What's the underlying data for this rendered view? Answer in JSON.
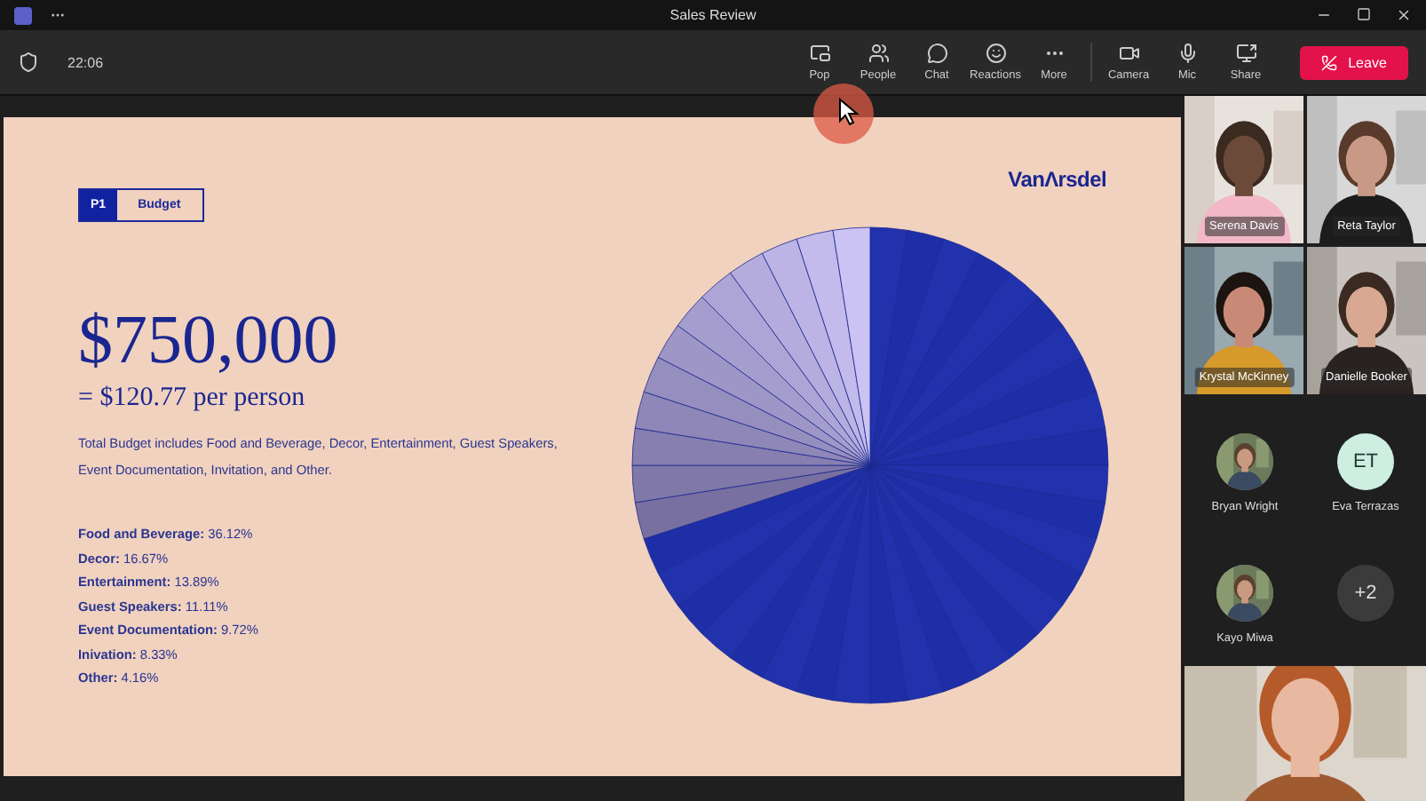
{
  "window": {
    "title": "Sales Review"
  },
  "toolbar": {
    "clock": "22:06",
    "buttons": [
      {
        "kind": "popout",
        "label": "Pop"
      },
      {
        "kind": "people",
        "label": "People"
      },
      {
        "kind": "chat",
        "label": "Chat"
      },
      {
        "kind": "reactions",
        "label": "Reactions"
      },
      {
        "kind": "more",
        "label": "More"
      },
      {
        "kind": "camera",
        "label": "Camera"
      },
      {
        "kind": "mic",
        "label": "Mic"
      },
      {
        "kind": "share",
        "label": "Share"
      }
    ],
    "leave": "Leave"
  },
  "slide": {
    "tag": {
      "number": "P1",
      "label": "Budget"
    },
    "logo": "VanΛrsdel",
    "amount": "$750,000",
    "per_person": "= $120.77 per person",
    "description": "Total Budget includes Food and Beverage, Decor, Entertainment, Guest Speakers, Event Documentation, Invitation, and Other.",
    "breakdown": [
      "**Food and Beverage:** 36.12%",
      "**Decor:** 16.67%",
      "**Entertainment:** 13.89%",
      "**Guest Speakers:** 11.11%",
      "**Event Documentation:** 9.72%",
      "**Inivation:** 8.33%",
      "**Other:** 4.16%"
    ]
  },
  "participants": {
    "videos": [
      {
        "name": "Serena Davis"
      },
      {
        "name": "Reta Taylor"
      },
      {
        "name": "Krystal McKinney"
      },
      {
        "name": "Danielle Booker"
      }
    ],
    "avatars": [
      {
        "name": "Bryan Wright"
      },
      {
        "kind": "initials",
        "initials": "ET",
        "name": "Eva Terrazas"
      },
      {
        "name": "Kayo Miwa"
      },
      {
        "kind": "more",
        "initials": "+2"
      }
    ]
  }
}
